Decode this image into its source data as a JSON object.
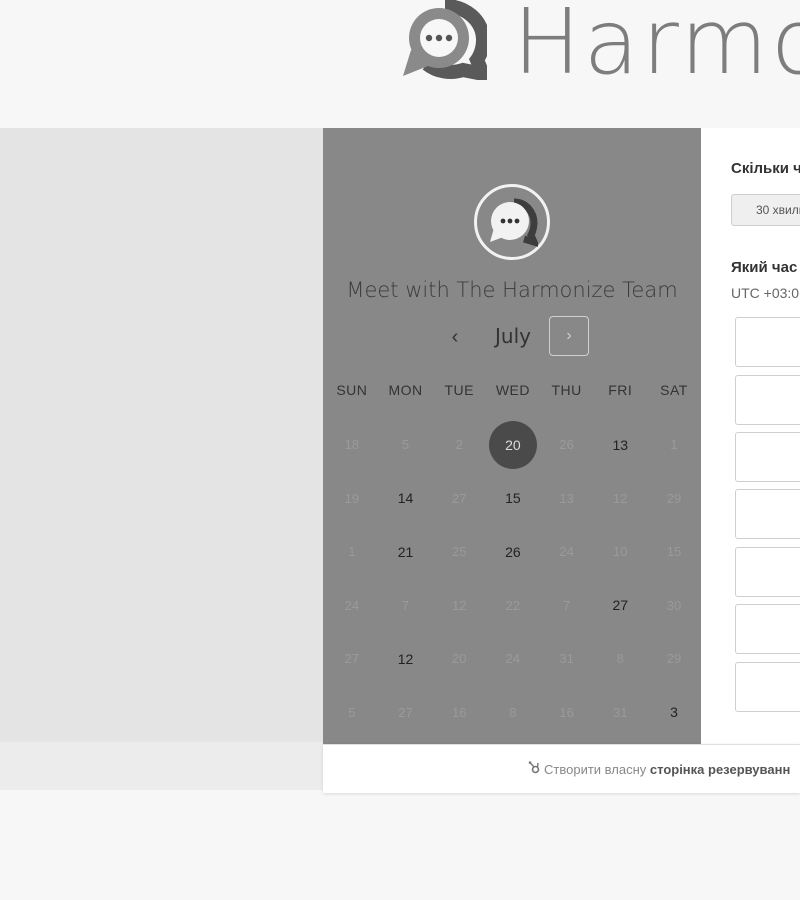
{
  "header": {
    "logo_text": "Harmo",
    "logo_icon": "chat-bubble-logo-icon"
  },
  "calendar": {
    "title": "Meet with The Harmonize Team",
    "month": "July",
    "prev_icon": "chevron-left-icon",
    "next_icon": "chevron-right-icon",
    "weekdays": [
      "SUN",
      "MON",
      "TUE",
      "WED",
      "THU",
      "FRI",
      "SAT"
    ],
    "weeks": [
      [
        "18",
        "5",
        "2",
        "20",
        "26",
        "13",
        "1"
      ],
      [
        "19",
        "14",
        "27",
        "15",
        "13",
        "12",
        "29"
      ],
      [
        "1",
        "21",
        "25",
        "26",
        "24",
        "10",
        "15"
      ],
      [
        "24",
        "7",
        "12",
        "22",
        "7",
        "27",
        "30"
      ],
      [
        "27",
        "12",
        "20",
        "24",
        "31",
        "8",
        "29"
      ],
      [
        "5",
        "27",
        "16",
        "8",
        "16",
        "31",
        "3"
      ]
    ],
    "available": [
      [
        0,
        3
      ],
      [
        0,
        5
      ],
      [
        1,
        1
      ],
      [
        1,
        3
      ],
      [
        2,
        1
      ],
      [
        2,
        3
      ],
      [
        3,
        5
      ],
      [
        4,
        1
      ],
      [
        5,
        6
      ]
    ],
    "selected": [
      0,
      3
    ]
  },
  "booking": {
    "duration_question": "Скільки ч",
    "duration_option": "30 хвили",
    "time_question": "Який час",
    "timezone": "UTC +03:0"
  },
  "footer": {
    "prefix": "Створити власну",
    "link": "сторінка резервуванн",
    "icon": "sprocket-icon"
  }
}
